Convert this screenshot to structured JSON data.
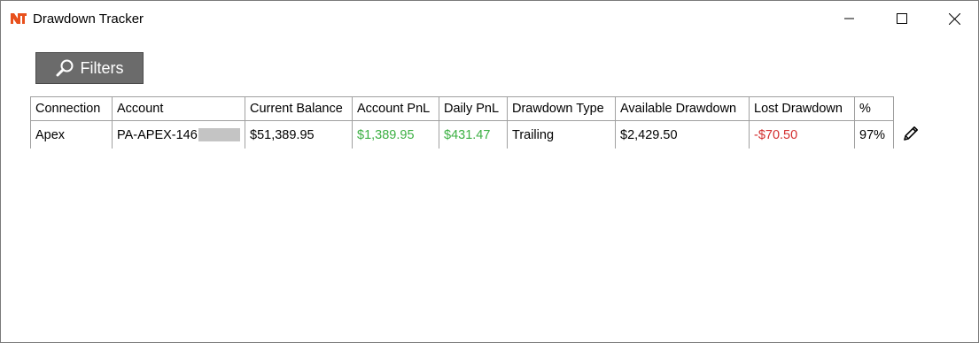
{
  "window": {
    "title": "Drawdown Tracker",
    "app_icon": "ninjatrader-logo-icon",
    "controls": [
      "minimize-icon",
      "maximize-icon",
      "close-icon"
    ]
  },
  "toolbar": {
    "filters_label": "Filters",
    "filters_icon": "search-icon"
  },
  "table": {
    "columns": [
      "Connection",
      "Account",
      "Current Balance",
      "Account PnL",
      "Daily PnL",
      "Drawdown Type",
      "Available Drawdown",
      "Lost Drawdown",
      "%"
    ],
    "rows": [
      {
        "connection": "Apex",
        "account": "PA-APEX-146",
        "current_balance": "$51,389.95",
        "account_pnl": "$1,389.95",
        "daily_pnl": "$431.47",
        "drawdown_type": "Trailing",
        "available_drawdown": "$2,429.50",
        "lost_drawdown": "-$70.50",
        "percent": "97%"
      }
    ]
  },
  "colors": {
    "positive": "#3cb043",
    "negative": "#d32f2f",
    "button_bg": "#6b6b6b"
  }
}
